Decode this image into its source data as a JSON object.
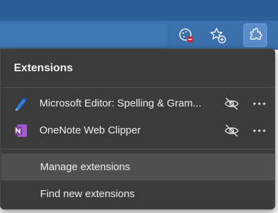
{
  "toolbar": {
    "icons": [
      "cookie-blocked-icon",
      "add-favorite-icon",
      "extensions-icon"
    ],
    "colors": {
      "chrome": "#3a70ab",
      "strip": "#2c5f95",
      "active": "#5a8ccb"
    }
  },
  "menu": {
    "title": "Extensions",
    "extensions": [
      {
        "name": "Microsoft Editor: Spelling & Gram...",
        "icon": "microsoft-editor-icon"
      },
      {
        "name": "OneNote Web Clipper",
        "icon": "onenote-icon"
      }
    ],
    "manage_label": "Manage extensions",
    "find_label": "Find new extensions",
    "colors": {
      "background": "#3b3b3b",
      "hover": "#505050",
      "text": "#f0f0f0",
      "onenote": "#7b3fa0"
    }
  }
}
